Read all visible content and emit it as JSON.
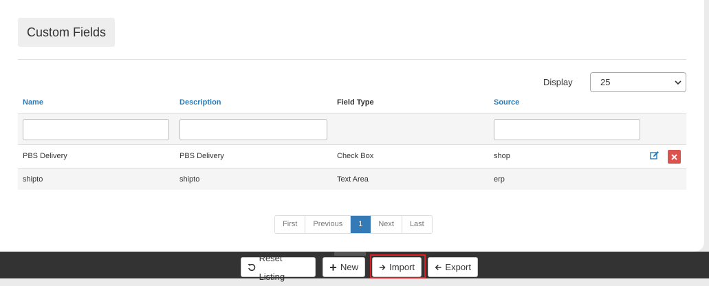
{
  "page": {
    "title": "Custom Fields"
  },
  "display": {
    "label": "Display",
    "selected": "25"
  },
  "table": {
    "columns": [
      {
        "label": "Name",
        "sortable": true
      },
      {
        "label": "Description",
        "sortable": true
      },
      {
        "label": "Field Type",
        "sortable": false
      },
      {
        "label": "Source",
        "sortable": true
      }
    ],
    "rows": [
      {
        "name": "PBS Delivery",
        "description": "PBS Delivery",
        "field_type": "Check Box",
        "source": "shop",
        "actions": [
          "edit-icon",
          "delete-icon"
        ]
      },
      {
        "name": "shipto",
        "description": "shipto",
        "field_type": "Text Area",
        "source": "erp",
        "actions": []
      }
    ]
  },
  "pagination": {
    "first": "First",
    "previous": "Previous",
    "current": "1",
    "next": "Next",
    "last": "Last"
  },
  "footer": {
    "reset_label": "Reset Listing",
    "new_label": "New",
    "import_label": "Import",
    "export_label": "Export"
  },
  "colors": {
    "link": "#2a7ab5",
    "active_page": "#337ab7",
    "delete": "#d9534f",
    "footer_bg": "#333333",
    "highlight": "#e02020"
  }
}
